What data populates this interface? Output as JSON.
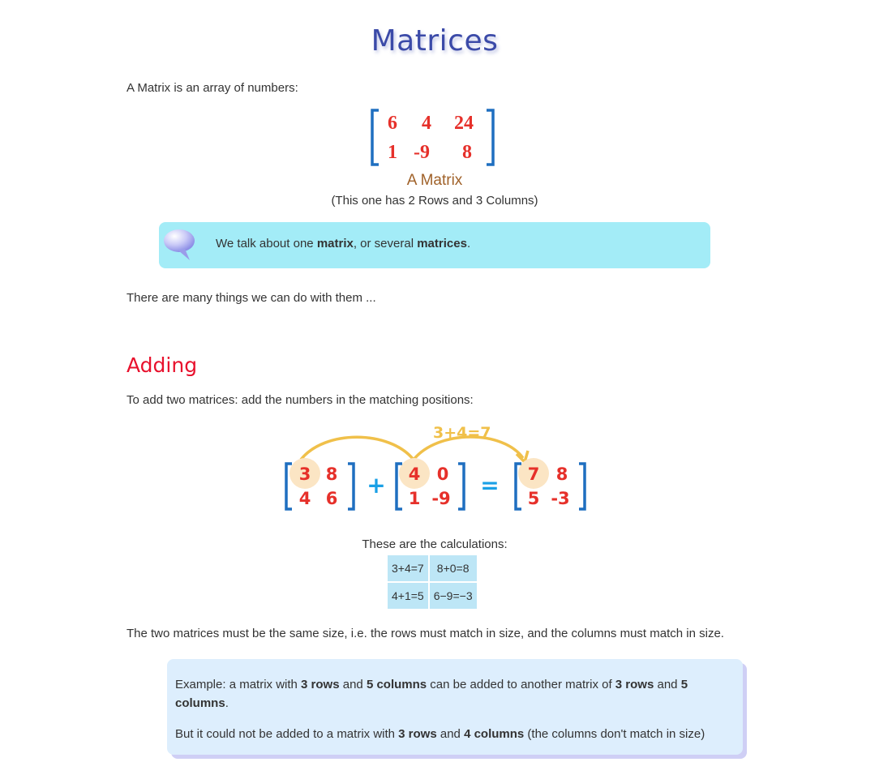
{
  "title": "Matrices",
  "intro": "A Matrix is an array of numbers:",
  "matrix_example": {
    "rows": [
      [
        "6",
        "4",
        "24"
      ],
      [
        "1",
        "-9",
        "8"
      ]
    ],
    "caption": "A Matrix",
    "subcaption": "(This one has 2 Rows and 3 Columns)"
  },
  "note": {
    "part1": "We talk about one ",
    "bold1": "matrix",
    "part2": ", or several ",
    "bold2": "matrices",
    "part3": "."
  },
  "many_things": "There are many things we can do with them ...",
  "adding": {
    "heading": "Adding",
    "intro": "To add two matrices: add the numbers in the matching positions:",
    "arrow_label": "3+4=7",
    "matrix_a": [
      [
        "3",
        "8"
      ],
      [
        "4",
        "6"
      ]
    ],
    "matrix_b": [
      [
        "4",
        "0"
      ],
      [
        "1",
        "-9"
      ]
    ],
    "matrix_c": [
      [
        "7",
        "8"
      ],
      [
        "5",
        "-3"
      ]
    ],
    "plus": "+",
    "equals": "=",
    "calc_caption": "These are the calculations:",
    "calc_table": [
      [
        "3+4=7",
        "8+0=8"
      ],
      [
        "4+1=5",
        "6−9=−3"
      ]
    ],
    "same_size": "The two matrices must be the same size, i.e. the rows must match in size, and the columns must match in size."
  },
  "example": {
    "line1_a": "Example: a matrix with ",
    "line1_b1": "3 rows",
    "line1_c": " and ",
    "line1_b2": "5 columns",
    "line1_d": " can be added to another matrix of ",
    "line1_b3": "3 rows",
    "line1_e": " and ",
    "line1_b4": "5 columns",
    "line1_f": ".",
    "line2_a": "But it could not be added to a matrix with ",
    "line2_b1": "3 rows",
    "line2_c": " and ",
    "line2_b2": "4 columns",
    "line2_d": " (the columns don't match in size)"
  },
  "colors": {
    "title": "#3b4aa8",
    "heading": "#e8112d",
    "matrix_number": "#e6302a",
    "bracket": "#1f6fc0",
    "highlight": "#fbe5c4",
    "arrow": "#f0c04a",
    "note_bg": "#a3ecf7",
    "example_bg": "#ddeefd"
  }
}
